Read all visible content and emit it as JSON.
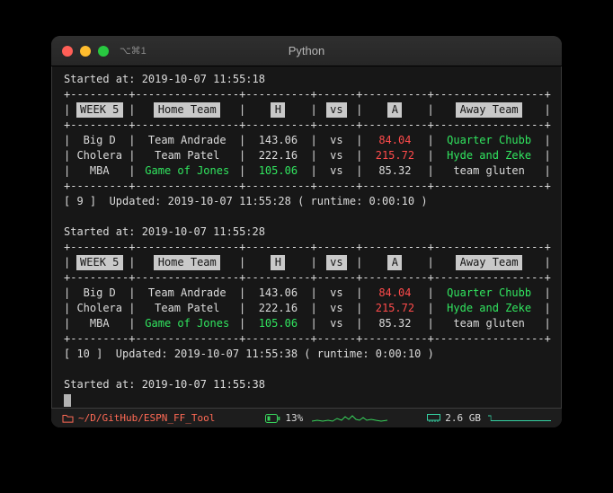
{
  "window": {
    "shortcut": "⌥⌘1",
    "title": "Python"
  },
  "output": {
    "session1": {
      "started": "Started at: 2019-10-07 11:55:18",
      "updated": "[ 9 ]  Updated: 2019-10-07 11:55:28 ( runtime: 0:00:10 )"
    },
    "session2": {
      "started": "Started at: 2019-10-07 11:55:28",
      "updated": "[ 10 ]  Updated: 2019-10-07 11:55:38 ( runtime: 0:00:10 )"
    },
    "final_started": "Started at: 2019-10-07 11:55:38"
  },
  "table": {
    "pipe": "|",
    "border": "+---------+----------------+----------+------+----------+-----------------+",
    "headers": [
      "WEEK 5",
      "Home Team",
      "H",
      "vs",
      "A",
      "Away Team"
    ],
    "rows": [
      [
        "Big D",
        "Team Andrade",
        "143.06",
        "vs",
        "84.04",
        "Quarter Chubb"
      ],
      [
        "Cholera",
        "Team Patel",
        "222.16",
        "vs",
        "215.72",
        "Hyde and Zeke"
      ],
      [
        "MBA",
        "Game of Jones",
        "105.06",
        "vs",
        "85.32",
        "team gluten"
      ]
    ]
  },
  "statusbar": {
    "path": "~/D/GitHub/ESPN_FF_Tool",
    "cpu_percent": "13%",
    "memory": "2.6 GB"
  },
  "icons": {
    "titlebar": [
      "close-icon",
      "minimize-icon",
      "zoom-icon"
    ],
    "statusbar": [
      "folder-icon",
      "battery-icon",
      "cpu-sparkline-icon",
      "memory-icon",
      "memory-graph-icon"
    ]
  },
  "colors": {
    "score_red": "#ff4b4b",
    "score_green": "#31e55f",
    "path_orange": "#ff6a55",
    "graph_green": "#37d35b",
    "mem_teal": "#35d1a2",
    "header_badge_bg": "#c9c9c9",
    "light_red": "#ff5f57",
    "light_yellow": "#febc2e",
    "light_green": "#28c840"
  }
}
